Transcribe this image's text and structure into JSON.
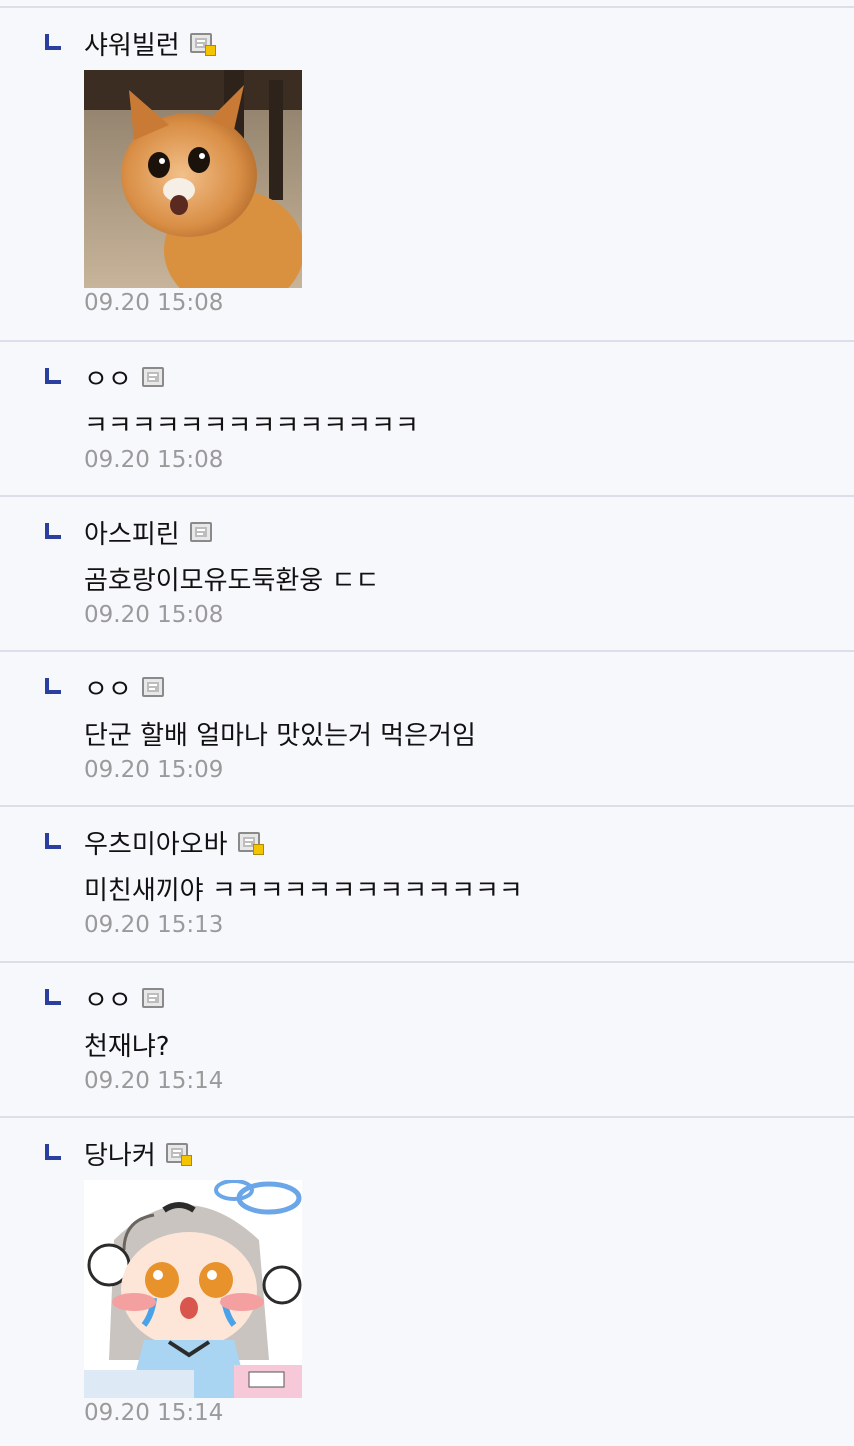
{
  "comments": [
    {
      "nick": "샤워빌런",
      "fixed_member": true,
      "type": "image",
      "image_desc": "crying-cat-meme",
      "time": "09.20 15:08"
    },
    {
      "nick": "ㅇㅇ",
      "fixed_member": false,
      "type": "text",
      "text": "ㅋㅋㅋㅋㅋㅋㅋㅋㅋㅋㅋㅋㅋㅋ",
      "time": "09.20 15:08"
    },
    {
      "nick": "아스피린",
      "fixed_member": false,
      "type": "text",
      "text": "곰호랑이모유도둑환웅 ㄷㄷ",
      "time": "09.20 15:08"
    },
    {
      "nick": "ㅇㅇ",
      "fixed_member": false,
      "type": "text",
      "text": "단군 할배 얼마나 맛있는거 먹은거임",
      "time": "09.20 15:09"
    },
    {
      "nick": "우츠미아오바",
      "fixed_member": true,
      "type": "text",
      "text": "미친새끼야 ㅋㅋㅋㅋㅋㅋㅋㅋㅋㅋㅋㅋㅋ",
      "time": "09.20 15:13"
    },
    {
      "nick": "ㅇㅇ",
      "fixed_member": false,
      "type": "text",
      "text": "천재냐?",
      "time": "09.20 15:14"
    },
    {
      "nick": "당나커",
      "fixed_member": true,
      "type": "image",
      "image_desc": "crying-anime-girl-sticker",
      "time": "09.20 15:14"
    }
  ],
  "colors": {
    "accent": "#2a3fa0",
    "timestamp": "#9a9a9a",
    "background": "#f7f8fc",
    "divider": "#dcdfea"
  }
}
